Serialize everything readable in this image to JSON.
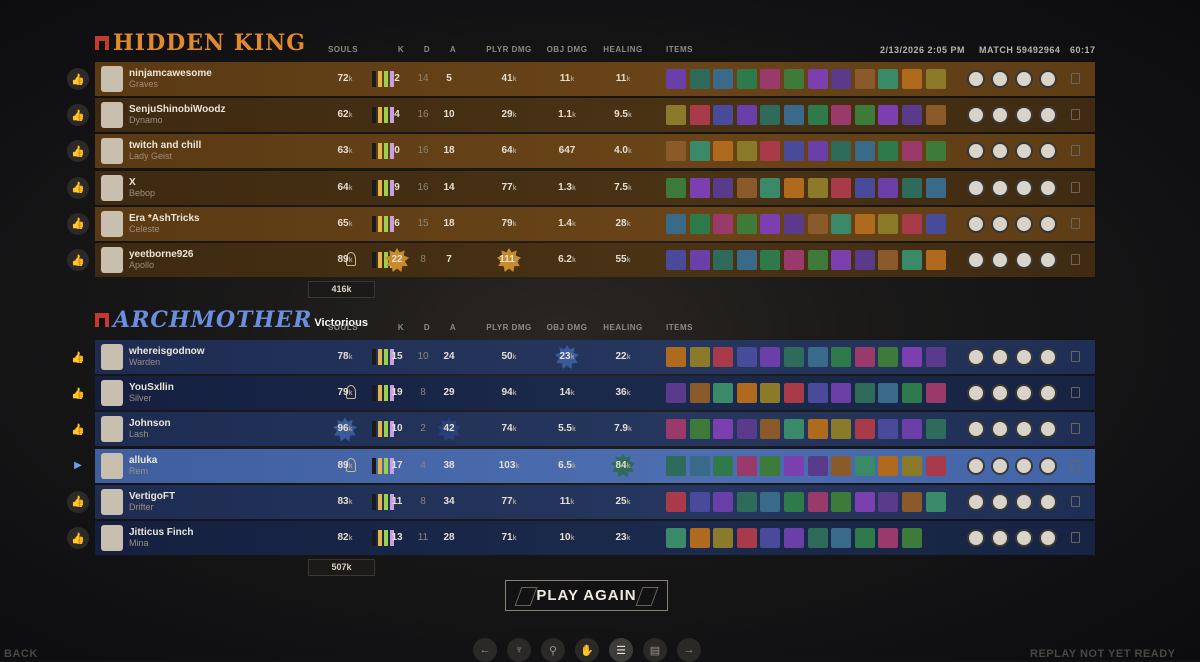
{
  "header": {
    "datetime": "2/13/2026 2:05 PM",
    "match": "MATCH 59492964",
    "duration": "60:17"
  },
  "columns": {
    "souls": "SOULS",
    "k": "K",
    "d": "D",
    "a": "A",
    "plyr_dmg": "PLYR DMG",
    "obj_dmg": "OBJ DMG",
    "healing": "HEALING",
    "items": "ITEMS"
  },
  "team_a": {
    "name": "HIDDEN KING",
    "total_souls": "416k",
    "players": [
      {
        "name": "ninjamcawesome",
        "hero": "Graves",
        "souls": "72",
        "k": "2",
        "d": "14",
        "a": "5",
        "plyr": "41",
        "obj": "11",
        "heal": "11"
      },
      {
        "name": "SenjuShinobiWoodz",
        "hero": "Dynamo",
        "souls": "62",
        "k": "4",
        "d": "16",
        "a": "10",
        "plyr": "29",
        "obj": "1.1",
        "heal": "9.5"
      },
      {
        "name": "twitch and chill",
        "hero": "Lady Geist",
        "souls": "63",
        "k": "0",
        "d": "16",
        "a": "18",
        "plyr": "64",
        "obj": "647",
        "heal": "4.0"
      },
      {
        "name": "X",
        "hero": "Bebop",
        "souls": "64",
        "k": "9",
        "d": "16",
        "a": "14",
        "plyr": "77",
        "obj": "1.3",
        "heal": "7.5"
      },
      {
        "name": "Era *AshTricks",
        "hero": "Celeste",
        "souls": "65",
        "k": "6",
        "d": "15",
        "a": "18",
        "plyr": "79",
        "obj": "1.4",
        "heal": "28"
      },
      {
        "name": "yeetborne926",
        "hero": "Apollo",
        "souls": "89",
        "k": "22",
        "d": "8",
        "a": "7",
        "plyr": "111",
        "obj": "6.2",
        "heal": "55"
      }
    ]
  },
  "team_b": {
    "name": "ARCHMOTHER",
    "result": "Victorious",
    "total_souls": "507k",
    "players": [
      {
        "name": "whereisgodnow",
        "hero": "Warden",
        "souls": "78",
        "k": "15",
        "d": "10",
        "a": "24",
        "plyr": "50",
        "obj": "23",
        "heal": "22"
      },
      {
        "name": "YouSxllin",
        "hero": "Silver",
        "souls": "79",
        "k": "19",
        "d": "8",
        "a": "29",
        "plyr": "94",
        "obj": "14",
        "heal": "36"
      },
      {
        "name": "Johnson",
        "hero": "Lash",
        "souls": "96",
        "k": "10",
        "d": "2",
        "a": "42",
        "plyr": "74",
        "obj": "5.5",
        "heal": "7.9"
      },
      {
        "name": "alluka",
        "hero": "Rem",
        "souls": "89",
        "k": "17",
        "d": "4",
        "a": "38",
        "plyr": "103",
        "obj": "6.5",
        "heal": "84"
      },
      {
        "name": "VertigoFT",
        "hero": "Drifter",
        "souls": "83",
        "k": "11",
        "d": "8",
        "a": "34",
        "plyr": "77",
        "obj": "11",
        "heal": "25"
      },
      {
        "name": "Jitticus Finch",
        "hero": "Mina",
        "souls": "82",
        "k": "13",
        "d": "11",
        "a": "28",
        "plyr": "71",
        "obj": "10",
        "heal": "23"
      }
    ]
  },
  "unit_k": "k",
  "buttons": {
    "play_again": "PLAY AGAIN",
    "back": "BACK"
  },
  "status": {
    "replay": "REPLAY NOT YET READY"
  },
  "nav": [
    "arrow-left",
    "trophy",
    "pin",
    "hands",
    "list",
    "chart",
    "arrow-right"
  ]
}
